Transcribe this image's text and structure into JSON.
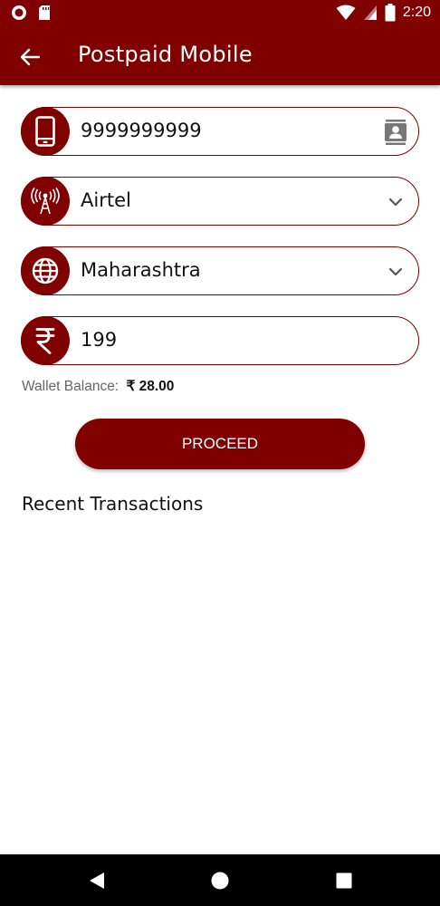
{
  "status_bar": {
    "time": "2:20"
  },
  "app_bar": {
    "title": "Postpaid Mobile"
  },
  "form": {
    "mobile_number": "9999999999",
    "operator": "Airtel",
    "circle": "Maharashtra",
    "amount": "199"
  },
  "wallet": {
    "label": "Wallet Balance:",
    "amount": "₹ 28.00"
  },
  "proceed_label": "PROCEED",
  "recent_transactions_title": "Recent Transactions",
  "colors": {
    "primary": "#800000",
    "background": "#ffffff"
  },
  "icons": {
    "mobile": "smartphone-icon",
    "contacts": "contacts-icon",
    "operator": "signal-tower-icon",
    "circle": "globe-icon",
    "amount": "rupee-icon"
  }
}
